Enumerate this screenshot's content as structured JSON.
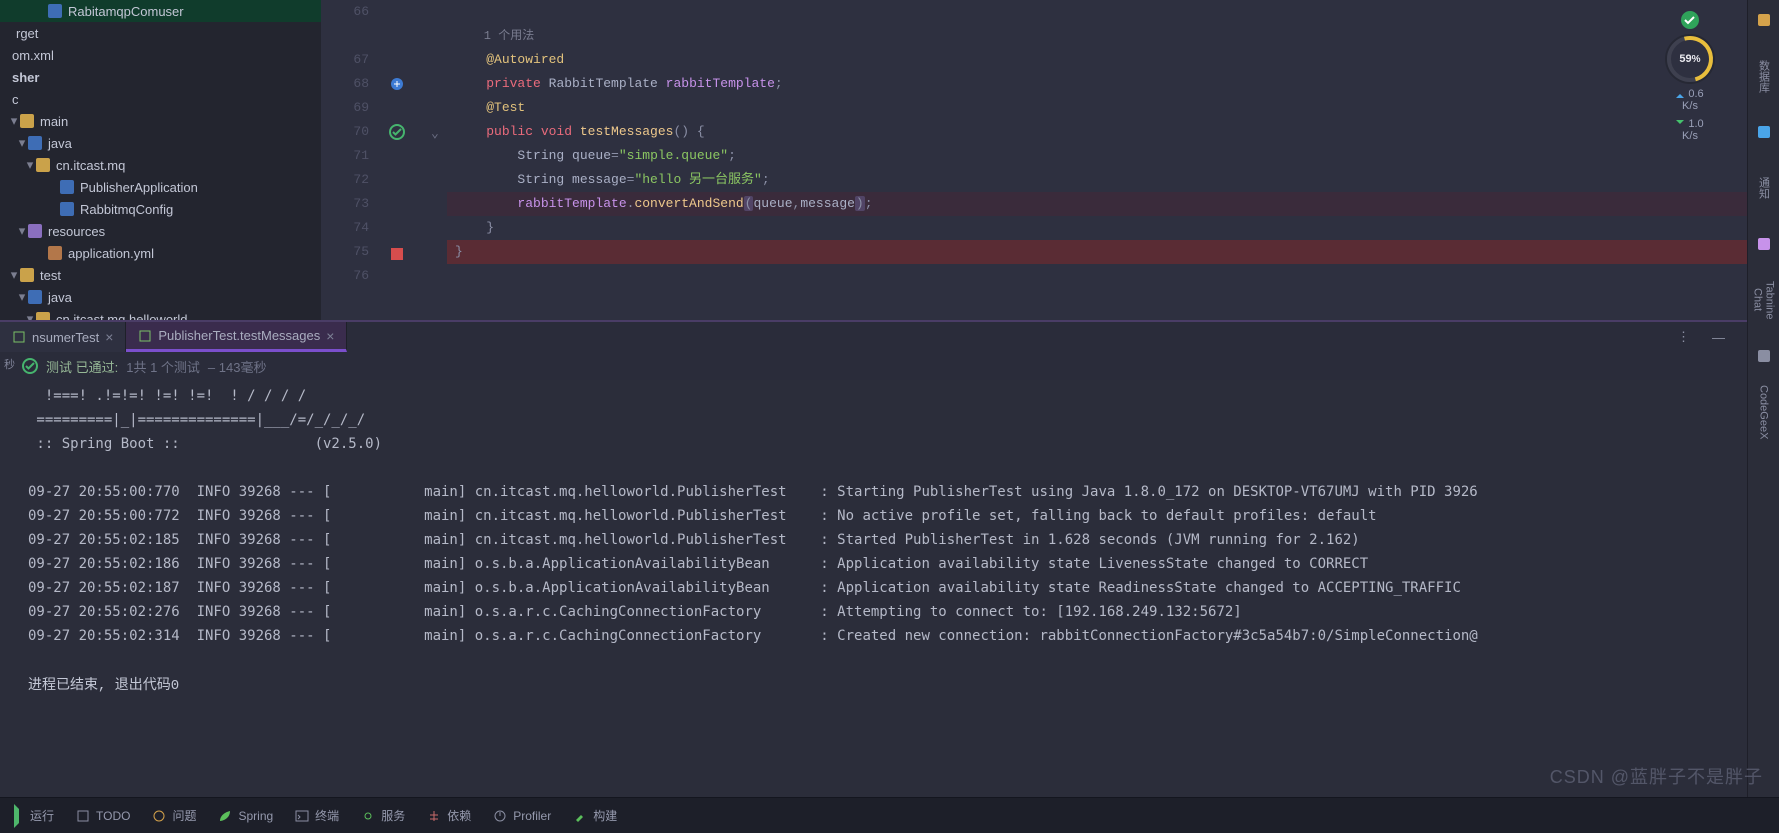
{
  "tree": {
    "nodes": [
      {
        "indent": 36,
        "icon": "cls",
        "label": "RabitamqpComuser",
        "selected": true
      },
      {
        "indent": 4,
        "icon": "",
        "label": "rget"
      },
      {
        "indent": 0,
        "icon": "",
        "label": "om.xml"
      },
      {
        "indent": 0,
        "icon": "",
        "label": "sher",
        "bold": true
      },
      {
        "indent": 0,
        "icon": "",
        "label": "c"
      },
      {
        "indent": 8,
        "icon": "folder",
        "label": "main",
        "arrow": "▾"
      },
      {
        "indent": 16,
        "icon": "java",
        "label": "java",
        "arrow": "▾"
      },
      {
        "indent": 24,
        "icon": "folder",
        "label": "cn.itcast.mq",
        "arrow": "▾"
      },
      {
        "indent": 48,
        "icon": "cls",
        "label": "PublisherApplication"
      },
      {
        "indent": 48,
        "icon": "cls",
        "label": "RabbitmqConfig"
      },
      {
        "indent": 16,
        "icon": "res",
        "label": "resources",
        "arrow": "▾"
      },
      {
        "indent": 36,
        "icon": "cfg",
        "label": "application.yml"
      },
      {
        "indent": 8,
        "icon": "folder",
        "label": "test",
        "arrow": "▾"
      },
      {
        "indent": 16,
        "icon": "java",
        "label": "java",
        "arrow": "▾"
      },
      {
        "indent": 24,
        "icon": "folder",
        "label": "cn.itcast.mq.helloworld",
        "arrow": "▾"
      }
    ]
  },
  "editor": {
    "usages_label": "1 个用法",
    "lines": [
      {
        "n": 66,
        "frags": []
      },
      {
        "n": 67,
        "frags": [
          {
            "t": "@Autowired",
            "c": "anno"
          }
        ]
      },
      {
        "n": 68,
        "mark": "impl",
        "frags": [
          {
            "t": "private ",
            "c": "kw"
          },
          {
            "t": "RabbitTemplate ",
            "c": "id"
          },
          {
            "t": "rabbitTemplate",
            "c": "field"
          },
          {
            "t": ";",
            "c": "punc"
          }
        ]
      },
      {
        "n": 69,
        "frags": [
          {
            "t": "@Test",
            "c": "anno"
          }
        ]
      },
      {
        "n": 70,
        "mark": "ok",
        "fold": true,
        "frags": [
          {
            "t": "public ",
            "c": "kw"
          },
          {
            "t": "void ",
            "c": "kw"
          },
          {
            "t": "testMessages",
            "c": "fn"
          },
          {
            "t": "() {",
            "c": "punc"
          }
        ]
      },
      {
        "n": 71,
        "indent": 1,
        "frags": [
          {
            "t": "String ",
            "c": "id"
          },
          {
            "t": "queue",
            "c": "id"
          },
          {
            "t": "=",
            "c": "punc"
          },
          {
            "t": "\"simple.queue\"",
            "c": "str"
          },
          {
            "t": ";",
            "c": "punc"
          }
        ]
      },
      {
        "n": 72,
        "indent": 1,
        "frags": [
          {
            "t": "String ",
            "c": "id"
          },
          {
            "t": "message",
            "c": "id"
          },
          {
            "t": "=",
            "c": "punc"
          },
          {
            "t": "\"hello 另一台服务\"",
            "c": "str"
          },
          {
            "t": ";",
            "c": "punc"
          }
        ]
      },
      {
        "n": 73,
        "hl": true,
        "indent": 1,
        "frags": [
          {
            "t": "rabbitTemplate",
            "c": "field"
          },
          {
            "t": ".",
            "c": "punc"
          },
          {
            "t": "convertAndSend",
            "c": "fn"
          },
          {
            "t": "(",
            "c": "punc",
            "sel": true
          },
          {
            "t": "queue",
            "c": "id"
          },
          {
            "t": ",",
            "c": "punc"
          },
          {
            "t": "message",
            "c": "id"
          },
          {
            "t": ")",
            "c": "punc",
            "sel": true
          },
          {
            "t": ";",
            "c": "punc"
          }
        ]
      },
      {
        "n": 74,
        "frags": [
          {
            "t": "}",
            "c": "punc"
          }
        ]
      },
      {
        "n": 75,
        "err": true,
        "mark": "stop",
        "frags": [
          {
            "t": "}",
            "c": "punc"
          }
        ],
        "outdent": true
      },
      {
        "n": 76,
        "frags": []
      }
    ],
    "meter": {
      "badge_ok": true,
      "pct": "59",
      "pct_suffix": "%",
      "up": "0.6",
      "up_unit": "K/s",
      "down": "1.0",
      "down_unit": "K/s"
    }
  },
  "runTabs": {
    "left_gutter_label": "秒",
    "tabs": [
      {
        "label": "nsumerTest",
        "active": false
      },
      {
        "label": "PublisherTest.testMessages",
        "active": true
      }
    ],
    "status_prefix": "测试 已通过:",
    "status_counts": "1共 1 个测试",
    "status_time": "– 143毫秒"
  },
  "console": {
    "ascii": "  !===! .!=!=! !=! !=!  ! / / / /\n =========|_|==============|___/=/_/_/_/\n :: Spring Boot ::                (v2.5.0)",
    "logs": [
      "09-27 20:55:00:770  INFO 39268 --- [           main] cn.itcast.mq.helloworld.PublisherTest    : Starting PublisherTest using Java 1.8.0_172 on DESKTOP-VT67UMJ with PID 3926",
      "09-27 20:55:00:772  INFO 39268 --- [           main] cn.itcast.mq.helloworld.PublisherTest    : No active profile set, falling back to default profiles: default",
      "09-27 20:55:02:185  INFO 39268 --- [           main] cn.itcast.mq.helloworld.PublisherTest    : Started PublisherTest in 1.628 seconds (JVM running for 2.162)",
      "09-27 20:55:02:186  INFO 39268 --- [           main] o.s.b.a.ApplicationAvailabilityBean      : Application availability state LivenessState changed to CORRECT",
      "09-27 20:55:02:187  INFO 39268 --- [           main] o.s.b.a.ApplicationAvailabilityBean      : Application availability state ReadinessState changed to ACCEPTING_TRAFFIC",
      "09-27 20:55:02:276  INFO 39268 --- [           main] o.s.a.r.c.CachingConnectionFactory       : Attempting to connect to: [192.168.249.132:5672]",
      "09-27 20:55:02:314  INFO 39268 --- [           main] o.s.a.r.c.CachingConnectionFactory       : Created new connection: rabbitConnectionFactory#3c5a54b7:0/SimpleConnection@"
    ],
    "exit": "进程已结束, 退出代码0"
  },
  "rightRail": {
    "items": [
      {
        "kind": "icon",
        "name": "database-icon",
        "color": "#d4a24b"
      },
      {
        "kind": "text",
        "label": "数据库"
      },
      {
        "kind": "icon",
        "name": "bell-icon",
        "color": "#4aa5e9"
      },
      {
        "kind": "text",
        "label": "通知"
      },
      {
        "kind": "icon",
        "name": "tabnine-icon",
        "color": "#c792ea"
      },
      {
        "kind": "text",
        "label": "Tabnine Chat"
      },
      {
        "kind": "icon",
        "name": "codegeex-icon",
        "color": "#8a8ea2"
      },
      {
        "kind": "text",
        "label": "CodeGeeX"
      }
    ]
  },
  "statusBar": {
    "items": [
      {
        "name": "run",
        "icon": "run-tri",
        "label": "运行"
      },
      {
        "name": "todo",
        "icon": "todo",
        "label": "TODO"
      },
      {
        "name": "problems",
        "icon": "bug",
        "label": "问题"
      },
      {
        "name": "spring",
        "icon": "leaf",
        "label": "Spring"
      },
      {
        "name": "terminal",
        "icon": "term",
        "label": "终端"
      },
      {
        "name": "services",
        "icon": "gear",
        "label": "服务"
      },
      {
        "name": "deps",
        "icon": "tree",
        "label": "依赖"
      },
      {
        "name": "profiler",
        "icon": "prof",
        "label": "Profiler"
      },
      {
        "name": "build",
        "icon": "hammer",
        "label": "构建"
      }
    ]
  },
  "watermark": "CSDN @蓝胖子不是胖子"
}
